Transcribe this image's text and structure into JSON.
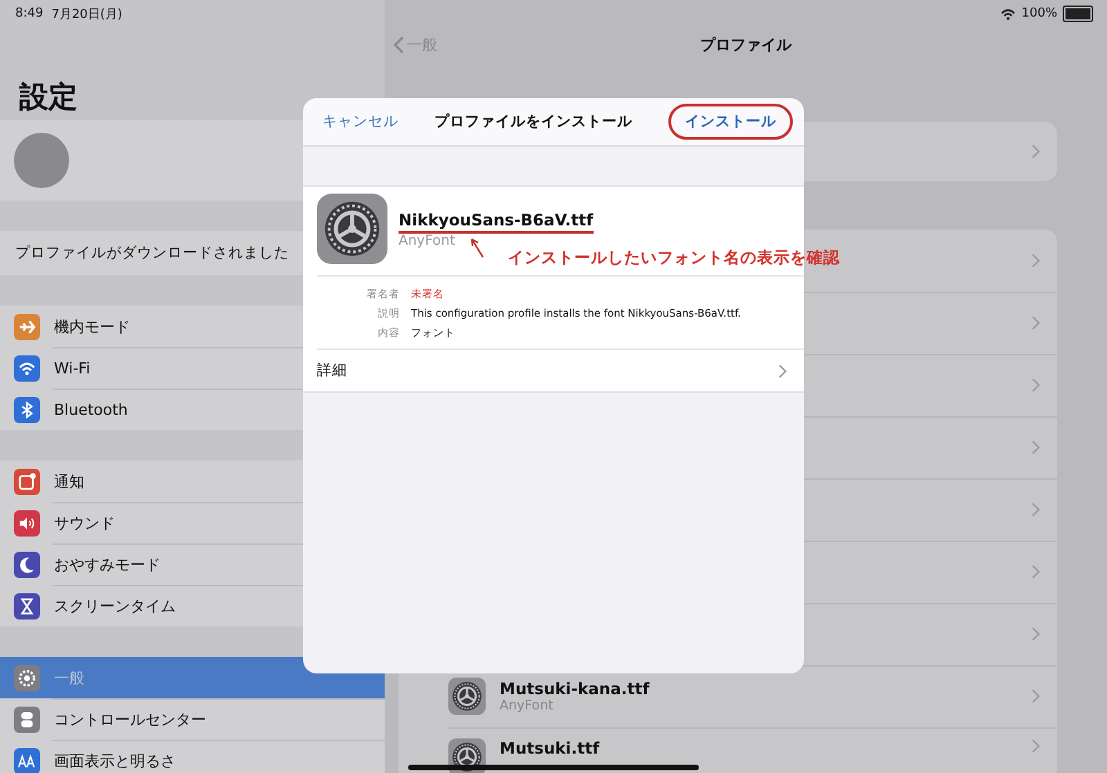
{
  "status_bar": {
    "time": "8:49",
    "date": "7月20日(月)",
    "battery": "100%"
  },
  "sidebar": {
    "title": "設定",
    "notice": "プロファイルがダウンロードされました",
    "groups": [
      [
        {
          "label": "機内モード",
          "color": "#d8853a",
          "selected": false
        },
        {
          "label": "Wi-Fi",
          "color": "#2f6fd6",
          "selected": false
        },
        {
          "label": "Bluetooth",
          "color": "#2f6fd6",
          "selected": false
        }
      ],
      [
        {
          "label": "通知",
          "color": "#d64a3a",
          "selected": false
        },
        {
          "label": "サウンド",
          "color": "#d0384a",
          "selected": false
        },
        {
          "label": "おやすみモード",
          "color": "#4a4aae",
          "selected": false
        },
        {
          "label": "スクリーンタイム",
          "color": "#4a4aae",
          "selected": false
        }
      ],
      [
        {
          "label": "一般",
          "color": "#7d7d82",
          "selected": true
        },
        {
          "label": "コントロールセンター",
          "color": "#7d7d82",
          "selected": false
        },
        {
          "label": "画面表示と明るさ",
          "color": "#2f6fd6",
          "selected": false
        }
      ]
    ]
  },
  "detail": {
    "back": "一般",
    "title": "プロファイル",
    "profiles": [
      {
        "kind": "covered"
      },
      {
        "kind": "covered"
      },
      {
        "kind": "covered"
      },
      {
        "kind": "covered"
      },
      {
        "kind": "covered"
      },
      {
        "kind": "covered"
      },
      {
        "kind": "covered"
      },
      {
        "kind": "font",
        "name": "Mutsuki-kana.ttf",
        "subtitle": "AnyFont"
      },
      {
        "kind": "font",
        "name": "Mutsuki.ttf"
      }
    ]
  },
  "dialog": {
    "cancel": "キャンセル",
    "title": "プロファイルをインストール",
    "install": {
      "label": "インストール",
      "circled": true
    },
    "profile": {
      "name": "NikkyouSans-B6aV.ttf",
      "underlined": true,
      "subtitle": "AnyFont"
    },
    "note": "インストールしたいフォント名の表示を確認",
    "fields": [
      {
        "label": "署名者",
        "value": "未署名",
        "kind": "warning"
      },
      {
        "label": "説明",
        "value": "This configuration profile installs the font NikkyouSans-B6aV.ttf.",
        "kind": "plain"
      },
      {
        "label": "内容",
        "value": "フォント",
        "kind": "plain"
      }
    ],
    "details_row": "詳細"
  }
}
